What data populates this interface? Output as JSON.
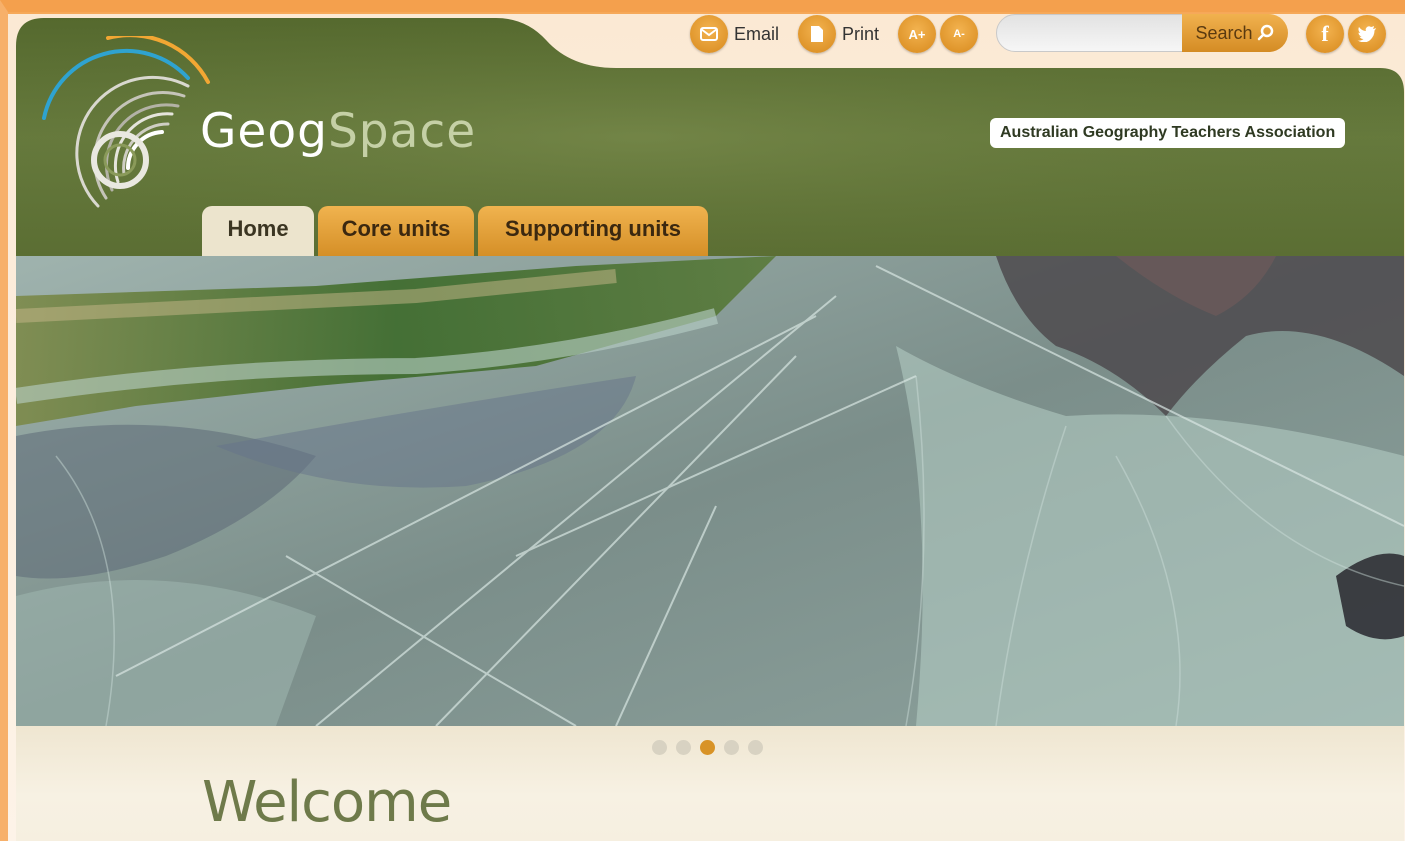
{
  "colors": {
    "accent": "#d89327",
    "header_green": "#5f7136",
    "tab_active": "#ece4cd",
    "welcome_text": "#6e7a4a"
  },
  "toolbar": {
    "email_label": "Email",
    "print_label": "Print",
    "font_increase_label": "A+",
    "font_decrease_label": "A-",
    "search_placeholder": "",
    "search_label": "Search",
    "icons": [
      "email-icon",
      "print-icon",
      "font-increase-icon",
      "font-decrease-icon",
      "search-icon",
      "facebook-icon",
      "twitter-icon"
    ]
  },
  "brand": {
    "logo_part1": "Geog",
    "logo_part2": "Space",
    "association": "Australian Geography Teachers Association"
  },
  "nav": {
    "tabs": [
      {
        "label": "Home",
        "active": true
      },
      {
        "label": "Core units",
        "active": false
      },
      {
        "label": "Supporting units",
        "active": false
      }
    ]
  },
  "slider": {
    "slide_count": 5,
    "active_slide": 3
  },
  "main": {
    "heading": "Welcome"
  }
}
